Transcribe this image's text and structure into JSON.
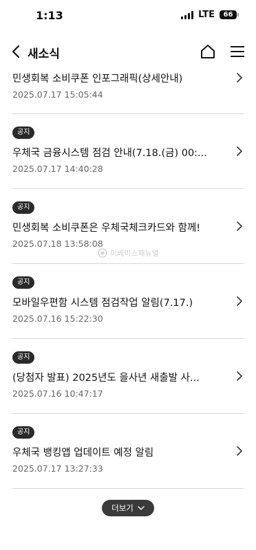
{
  "status_bar": {
    "time": "1:13",
    "network": "LTE",
    "battery": "66"
  },
  "header": {
    "title": "새소식"
  },
  "notices": [
    {
      "badge": "",
      "title": "민생회복 소비쿠폰 인포그래픽(상세안내)",
      "date": "2025.07.17 15:05:44"
    },
    {
      "badge": "공지",
      "title": "우체국 금융시스템 점검 안내(7.18.(금) 00:...",
      "date": "2025.07.17 14:40:28"
    },
    {
      "badge": "공지",
      "title": "민생회복 소비쿠폰은 우체국체크카드와 함께!",
      "date": "2025.07.18 13:58:08"
    },
    {
      "badge": "공지",
      "title": "모바일우편함 시스템 점검작업 알림(7.17.)",
      "date": "2025.07.16 15:22:30"
    },
    {
      "badge": "공지",
      "title": "(당첨자 발표) 2025년도 을사년 새출발 사...",
      "date": "2025.07.16 10:47:17"
    },
    {
      "badge": "공지",
      "title": "우체국 뱅킹앱 업데이트 예정 알림",
      "date": "2025.07.17 13:27:33"
    }
  ],
  "more_button": {
    "label": "더보기"
  },
  "watermark": {
    "text": "이베이스패뉴얼"
  },
  "icons": {
    "back": "chevron-left-icon",
    "home": "home-icon",
    "menu": "hamburger-menu-icon",
    "item_arrow": "chevron-right-icon",
    "more_arrow": "chevron-down-icon"
  }
}
